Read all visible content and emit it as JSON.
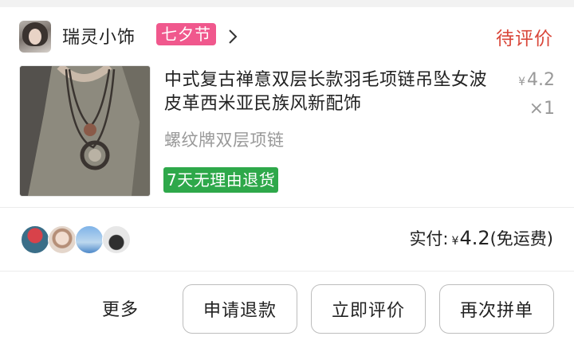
{
  "shop": {
    "name": "瑞灵小饰",
    "badge": "七夕节",
    "order_status": "待评价"
  },
  "product": {
    "title": "中式复古禅意双层长款羽毛项链吊坠女波皮革西米亚民族风新配饰",
    "price_symbol": "¥",
    "price": "4.2",
    "quantity": "×1",
    "spec": "螺纹牌双层项链",
    "return_tag": "7天无理由退货"
  },
  "summary": {
    "paid_label": "实付:",
    "currency": "¥",
    "amount": "4.2",
    "shipping_note": "(免运费)"
  },
  "actions": {
    "more": "更多",
    "refund": "申请退款",
    "review": "立即评价",
    "regroup": "再次拼单"
  },
  "colors": {
    "status_red": "#d9473a",
    "badge_pink": "#f0588d",
    "return_green": "#2ea84a"
  }
}
